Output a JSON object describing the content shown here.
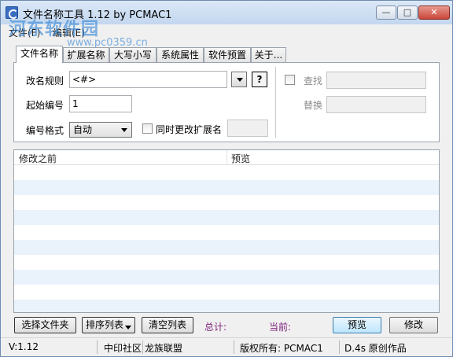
{
  "window": {
    "title": "文件名称工具 1.12  by PCMAC1",
    "watermark": "河东软件园",
    "watermark_url": "www.pc0359.cn",
    "minimize_glyph": "—",
    "maximize_glyph": "□",
    "close_glyph": "✕"
  },
  "menu": [
    {
      "label": "文件(F)"
    },
    {
      "label": "编辑(E)"
    }
  ],
  "tabs": [
    {
      "label": "文件名称",
      "active": true
    },
    {
      "label": "扩展名称"
    },
    {
      "label": "大写小写"
    },
    {
      "label": "系统属性"
    },
    {
      "label": "软件预置"
    },
    {
      "label": "关于..."
    }
  ],
  "form": {
    "rename_rule_label": "改名规则",
    "rename_rule_value": "<#>",
    "help_label": "?",
    "start_number_label": "起始编号",
    "start_number_value": "1",
    "number_format_label": "编号格式",
    "number_format_value": "自动",
    "change_ext_label": "同时更改扩展名",
    "change_ext_value": "",
    "find_label": "查找",
    "find_value": "",
    "replace_label": "替换",
    "replace_value": ""
  },
  "list": {
    "columns": [
      "修改之前",
      "预览"
    ],
    "rows": []
  },
  "actions": {
    "select_files": "选择文件夹",
    "sort_list": "排序列表",
    "clear_list": "清空列表",
    "total_label": "总计:",
    "current_label": "当前:",
    "preview": "预览",
    "modify": "修改"
  },
  "statusbar": {
    "version": "V:1.12",
    "community": "中印社区",
    "group": "龙族联盟",
    "copyright": "版权所有: PCMAC1",
    "credit": "D.4s 原创作品"
  }
}
